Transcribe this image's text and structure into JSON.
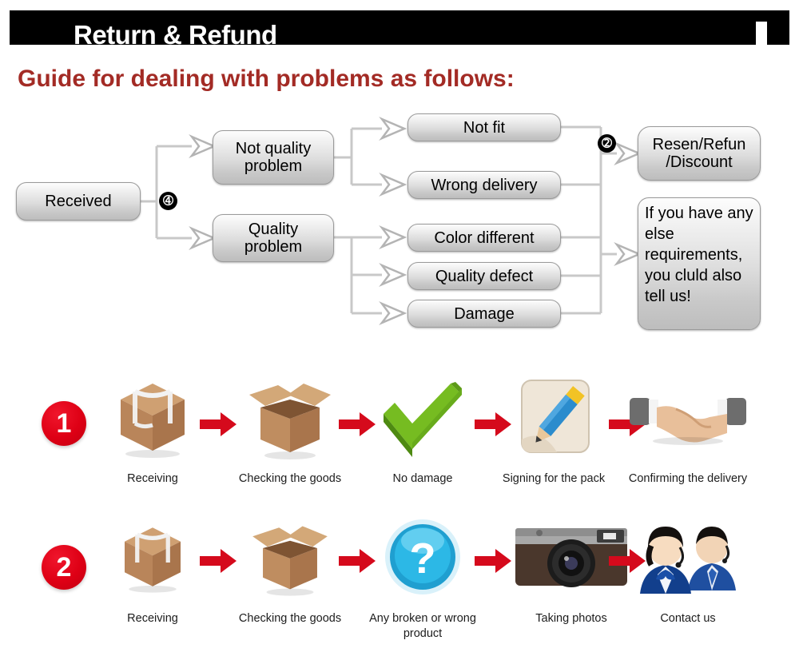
{
  "header": {
    "title": "Return & Refund",
    "arrow_icon": "down-arrow-icon"
  },
  "section": {
    "title": "Guide for dealing with problems as follows:",
    "title_color": "#A32B25"
  },
  "flowchart": {
    "start": {
      "label": "Received"
    },
    "branch_badge": "➃",
    "merge_badge": "➁",
    "categories": [
      {
        "label": "Not quality\nproblem"
      },
      {
        "label": "Quality\nproblem"
      }
    ],
    "issues": [
      {
        "label": "Not fit"
      },
      {
        "label": "Wrong delivery"
      },
      {
        "label": "Color different"
      },
      {
        "label": "Quality defect"
      },
      {
        "label": "Damage"
      }
    ],
    "outcomes": [
      {
        "label": "Resen/Refun\n/Discount"
      },
      {
        "label": "If you have any else requirements, you cluld also tell us!"
      }
    ]
  },
  "process": {
    "rows": [
      {
        "number": "1",
        "steps": [
          {
            "caption": "Receiving",
            "icon": "closed-box-icon"
          },
          {
            "caption": "Checking the goods",
            "icon": "open-box-icon"
          },
          {
            "caption": "No damage",
            "icon": "green-check-icon"
          },
          {
            "caption": "Signing for the pack",
            "icon": "pencil-signing-icon"
          },
          {
            "caption": "Confirming the delivery",
            "icon": "handshake-icon"
          }
        ]
      },
      {
        "number": "2",
        "steps": [
          {
            "caption": "Receiving",
            "icon": "closed-box-icon"
          },
          {
            "caption": "Checking the goods",
            "icon": "open-box-icon"
          },
          {
            "caption": "Any broken or wrong product",
            "icon": "blue-question-icon"
          },
          {
            "caption": "Taking photos",
            "icon": "camera-icon"
          },
          {
            "caption": "Contact us",
            "icon": "support-agents-icon"
          }
        ]
      }
    ],
    "arrow_icon": "red-right-arrow-icon"
  },
  "colors": {
    "header_bg": "#000000",
    "header_text": "#FFFFFF",
    "accent_red": "#A32B25",
    "step_red": "#DE0015",
    "box_border": "#9A9A9A",
    "connector": "#C8C8C8"
  }
}
